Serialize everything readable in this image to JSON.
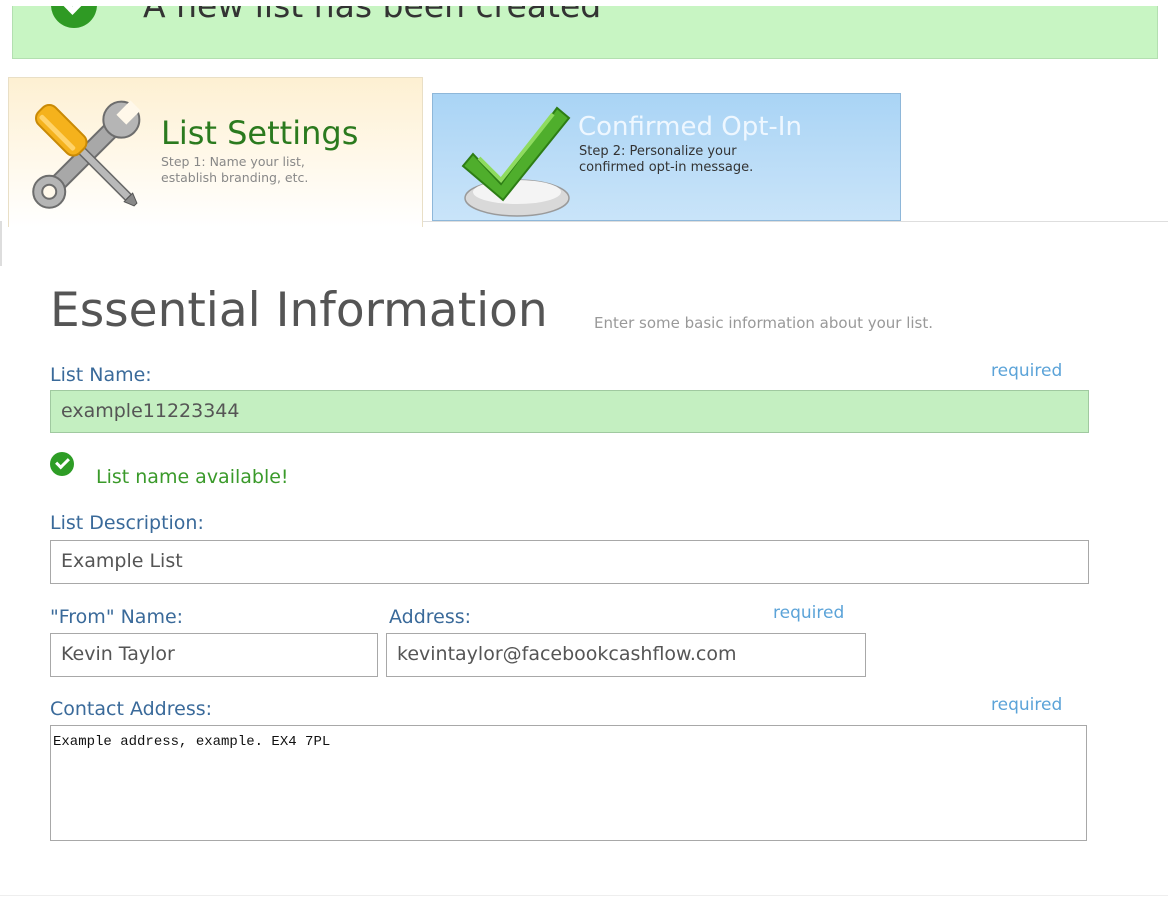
{
  "banner": {
    "message": "A new list has been created"
  },
  "steps": [
    {
      "title": "List Settings",
      "desc_line1": "Step 1: Name your list,",
      "desc_line2": "establish branding, etc."
    },
    {
      "title": "Confirmed Opt-In",
      "desc_line1": "Step 2: Personalize your",
      "desc_line2": "confirmed opt-in message."
    }
  ],
  "section": {
    "title": "Essential Information",
    "subtitle": "Enter some basic information about your list."
  },
  "form": {
    "list_name_label": "List Name:",
    "list_name_required": "required",
    "list_name_value": "example11223344",
    "availability_text": "List name available!",
    "description_label": "List Description:",
    "description_value": "Example List",
    "from_name_label": "\"From\" Name:",
    "from_name_value": "Kevin Taylor",
    "address_label": "Address:",
    "address_required": "required",
    "address_value": "kevintaylor@facebookcashflow.com",
    "contact_label": "Contact Address:",
    "contact_required": "required",
    "contact_value": "Example address, example. EX4 7PL"
  },
  "colors": {
    "success_bg": "#c8f5c3",
    "tab_active_title": "#2b7a1e",
    "tab_inactive_bg": "#badcf7",
    "label": "#3a6a9a",
    "required": "#5ba3d8"
  }
}
